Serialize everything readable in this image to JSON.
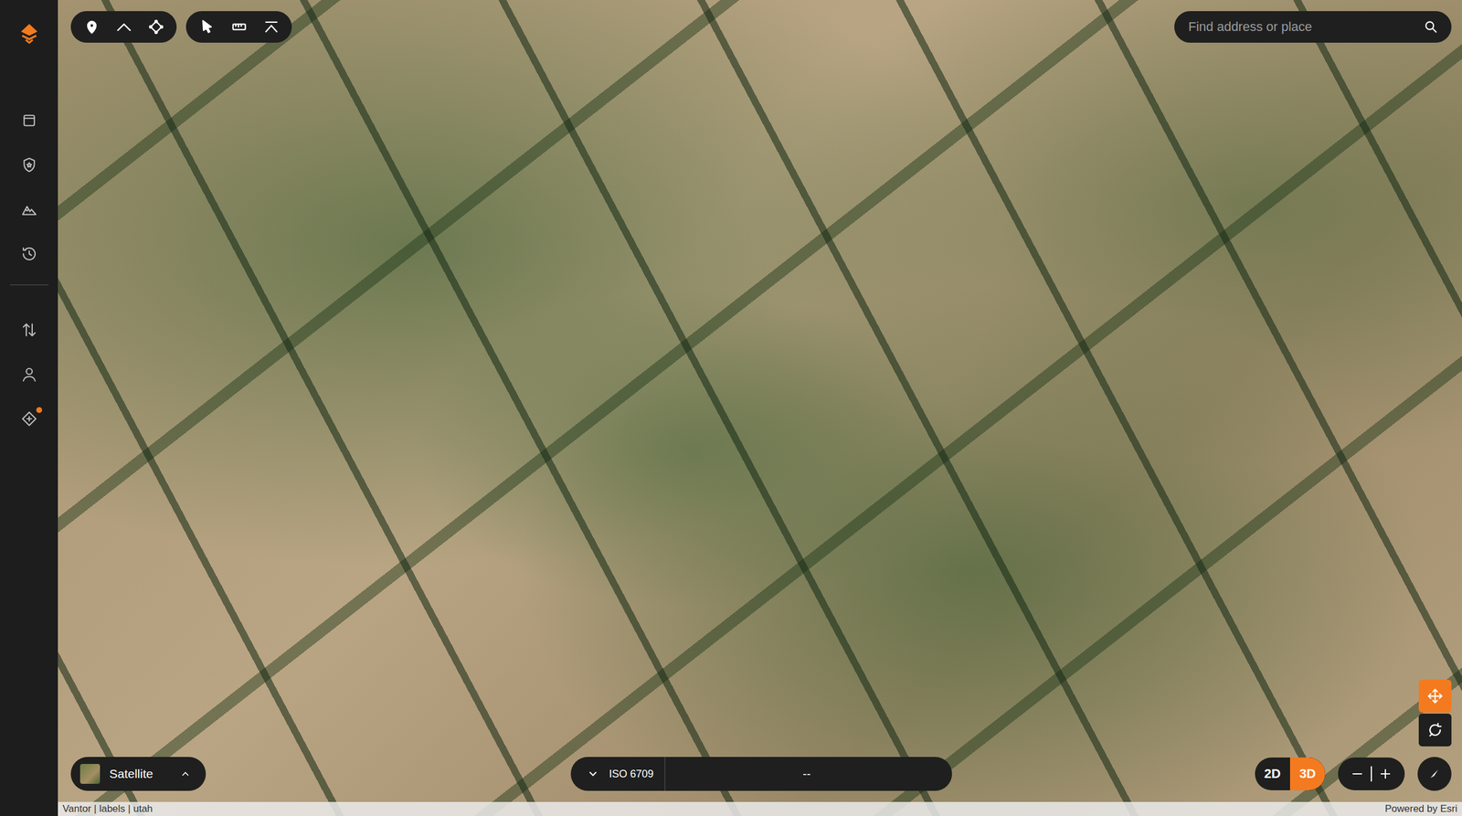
{
  "sidebar": {
    "items": [
      {
        "kind": "layers",
        "badge": false,
        "selected": false
      },
      {
        "kind": "shield",
        "badge": false,
        "selected": false
      },
      {
        "kind": "peaks",
        "badge": false,
        "selected": false
      },
      {
        "kind": "history",
        "badge": false,
        "selected": false
      },
      {
        "kind": "transfer",
        "badge": false,
        "selected": false
      },
      {
        "kind": "user",
        "badge": false,
        "selected": false
      },
      {
        "kind": "diamond",
        "badge": true,
        "selected": false
      }
    ]
  },
  "toolbar": {
    "groups": [
      [
        {
          "kind": "marker",
          "selected": false
        },
        {
          "kind": "route",
          "selected": false
        },
        {
          "kind": "area",
          "selected": false
        }
      ],
      [
        {
          "kind": "select",
          "selected": false
        },
        {
          "kind": "measure",
          "selected": false
        },
        {
          "kind": "profile",
          "selected": false
        }
      ]
    ]
  },
  "search": {
    "placeholder": "Find address or place"
  },
  "basemap": {
    "label": "Satellite"
  },
  "coordinates": {
    "format": "ISO 6709",
    "reading": "--"
  },
  "view_modes": [
    {
      "label": "2D",
      "selected": false
    },
    {
      "label": "3D",
      "selected": true
    }
  ],
  "map_controls": [
    {
      "kind": "pan",
      "selected": true
    },
    {
      "kind": "rotate",
      "selected": false
    }
  ],
  "attribution": "Vantor | labels | utah",
  "credit": "Powered by Esri"
}
